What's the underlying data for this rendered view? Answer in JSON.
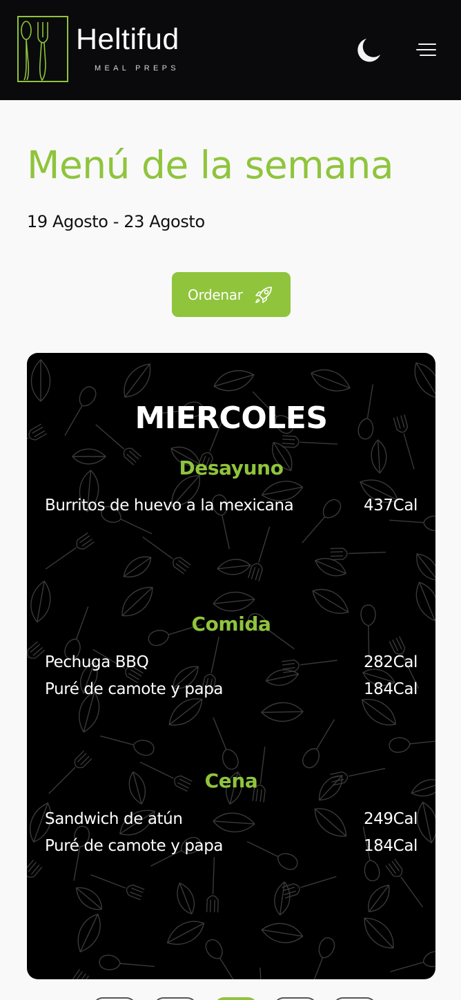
{
  "header": {
    "brand_name": "Heltifud",
    "brand_sub": "MEAL PREPS",
    "logo_icon": "fork-spoon-logo",
    "theme_icon": "moon-icon",
    "menu_icon": "hamburger-menu-icon"
  },
  "page": {
    "title": "Menú de la semana",
    "date_range": "19 Agosto - 23 Agosto",
    "order_label": "Ordenar",
    "order_icon": "rocket-icon"
  },
  "day": {
    "name": "MIERCOLES",
    "sections": [
      {
        "title": "Desayuno",
        "items": [
          {
            "name": "Burritos de huevo a la mexicana",
            "cal": "437Cal"
          }
        ]
      },
      {
        "title": "Comida",
        "items": [
          {
            "name": "Pechuga BBQ",
            "cal": "282Cal"
          },
          {
            "name": "Puré de camote y papa",
            "cal": "184Cal"
          }
        ]
      },
      {
        "title": "Cena",
        "items": [
          {
            "name": "Sandwich de atún",
            "cal": "249Cal"
          },
          {
            "name": "Puré de camote y papa",
            "cal": "184Cal"
          }
        ]
      }
    ]
  },
  "pagination": {
    "active_index": 2,
    "count": 5
  },
  "colors": {
    "accent": "#8fc43c",
    "header_bg": "#0a0a0c",
    "card_bg": "#000000",
    "page_bg": "#f9f9f9"
  }
}
